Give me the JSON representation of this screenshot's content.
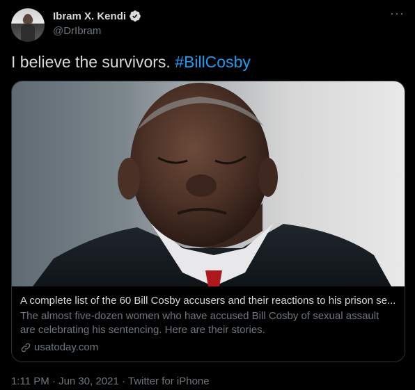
{
  "author": {
    "display_name": "Ibram X. Kendi",
    "handle": "@DrIbram",
    "verified": true
  },
  "tweet": {
    "text": "I believe the survivors. ",
    "hashtag": "#BillCosby"
  },
  "card": {
    "title": "A complete list of the 60 Bill Cosby accusers and their reactions to his prison se...",
    "description": "The almost five-dozen women who have accused Bill Cosby of sexual assault are celebrating his sentencing. Here are their stories.",
    "domain": "usatoday.com"
  },
  "meta": {
    "timestamp": "1:11 PM · Jun 30, 2021 · Twitter for iPhone"
  },
  "colors": {
    "background": "#000000",
    "text": "#d9d9d9",
    "muted": "#6e767d",
    "accent": "#1d9bf0",
    "border": "#2f3336"
  },
  "icons": {
    "verified": "verified-badge-icon",
    "more": "more-icon",
    "link": "link-icon"
  }
}
